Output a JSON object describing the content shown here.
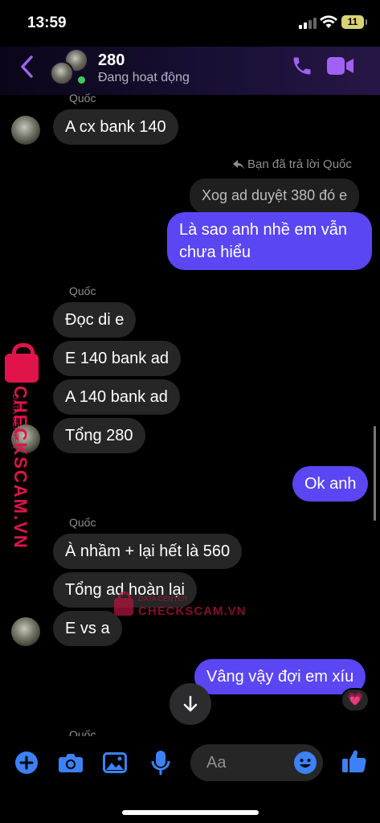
{
  "status_bar": {
    "time": "13:59",
    "battery": "11"
  },
  "header": {
    "name": "280",
    "status": "Đang hoạt động",
    "icons": {
      "back": "chevron-left-icon",
      "call": "phone-icon",
      "video": "video-camera-icon"
    },
    "accent": "#a061f4"
  },
  "messages": {
    "sender_name": "Quốc",
    "m1": "A cx bank 140",
    "reply_note": "Bạn đã trả lời Quốc",
    "quoted": "Xog ad duyệt 380 đó e",
    "m2": "Là sao anh nhề em vẫn chưa hiểu",
    "m3": "Đọc di e",
    "m4": "E 140 bank ad",
    "m5": "A 140 bank ad",
    "m6": "Tổng 280",
    "m7": "Ok anh",
    "m8": "À nhầm + lại hết là 560",
    "m9": "Tổng ad hoàn lại",
    "m10": "E vs a",
    "m11": "Vâng vậy đợi em xíu",
    "reaction": "💗",
    "colors": {
      "incoming": "#262626",
      "outgoing": "#5b46f4"
    }
  },
  "watermark": {
    "main": "CHECKSCAM.VN",
    "sub": "DATA CENTER"
  },
  "composer": {
    "placeholder": "Aa",
    "icons": [
      "plus-circle-icon",
      "camera-icon",
      "image-icon",
      "microphone-icon",
      "emoji-icon",
      "thumbs-up-icon"
    ]
  }
}
